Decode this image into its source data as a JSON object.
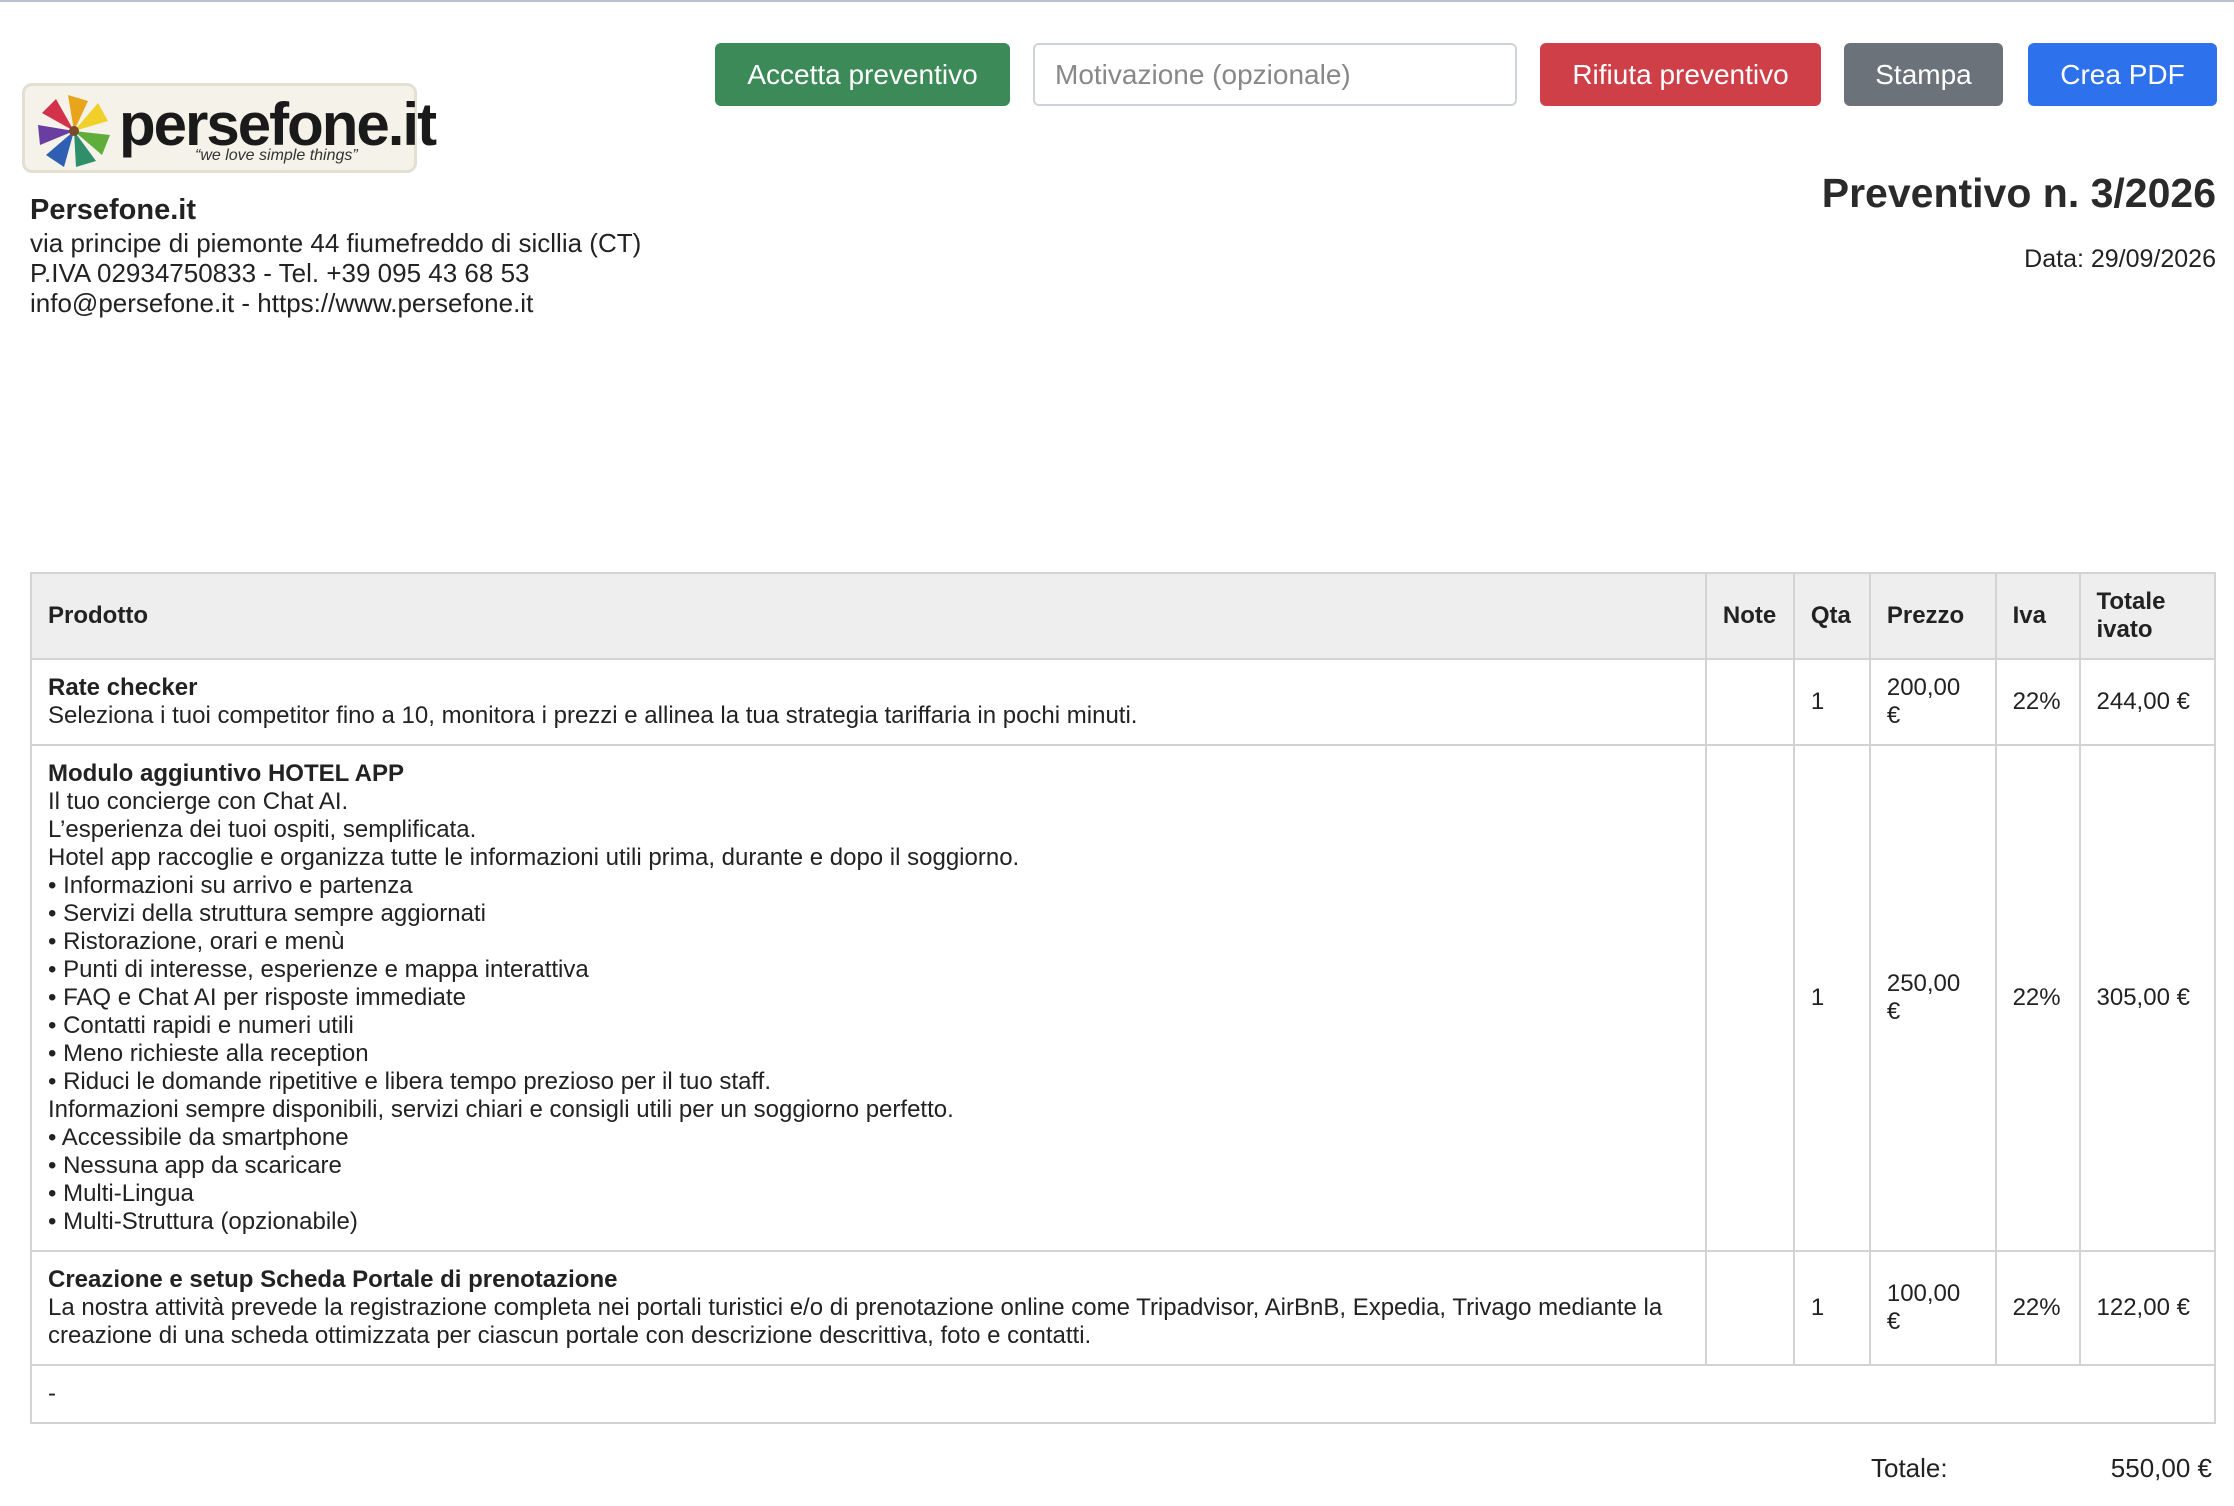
{
  "toolbar": {
    "accept_label": "Accetta preventivo",
    "reason_placeholder": "Motivazione (opzionale)",
    "reject_label": "Rifiuta preventivo",
    "print_label": "Stampa",
    "pdf_label": "Crea PDF"
  },
  "logo": {
    "text": "persefone.it",
    "tagline": "“we love simple things”"
  },
  "company": {
    "name": "Persefone.it",
    "address": "via principe di piemonte 44 fiumefreddo di sicllia (CT)",
    "vat_phone": "P.IVA 02934750833 - Tel. +39 095 43 68 53",
    "contacts": "info@persefone.it - https://www.persefone.it"
  },
  "quote": {
    "title": "Preventivo n. 3/2026",
    "date": "Data: 29/09/2026"
  },
  "table": {
    "headers": {
      "product": "Prodotto",
      "note": "Note",
      "qty": "Qta",
      "price": "Prezzo",
      "vat": "Iva",
      "total": "Totale ivato"
    },
    "rows": [
      {
        "name": "Rate checker",
        "description": "Seleziona i tuoi competitor fino a 10, monitora i prezzi e allinea la tua strategia tariffaria in pochi minuti.",
        "note": "",
        "qty": "1",
        "price": "200,00 €",
        "vat": "22%",
        "total": "244,00 €"
      },
      {
        "name": "Modulo aggiuntivo HOTEL APP",
        "description": "Il tuo concierge con Chat AI.\nL’esperienza dei tuoi ospiti, semplificata.\nHotel app raccoglie e organizza tutte le informazioni utili prima, durante e dopo il soggiorno.\n• Informazioni su arrivo e partenza\n• Servizi della struttura sempre aggiornati\n• Ristorazione, orari e menù\n• Punti di interesse, esperienze e mappa interattiva\n• FAQ e Chat AI per risposte immediate\n• Contatti rapidi e numeri utili\n• Meno richieste alla reception\n• Riduci le domande ripetitive e libera tempo prezioso per il tuo staff.\nInformazioni sempre disponibili, servizi chiari e consigli utili per un soggiorno perfetto.\n• Accessibile da smartphone\n• Nessuna app da scaricare\n• Multi-Lingua\n• Multi-Struttura (opzionabile)",
        "note": "",
        "qty": "1",
        "price": "250,00 €",
        "vat": "22%",
        "total": "305,00 €"
      },
      {
        "name": "Creazione e setup Scheda Portale di prenotazione",
        "description": "La nostra attività prevede la registrazione completa nei portali turistici e/o di prenotazione online come Tripadvisor, AirBnB, Expedia, Trivago mediante la creazione di una scheda ottimizzata per ciascun portale con descrizione descrittiva, foto e contatti.",
        "note": "",
        "qty": "1",
        "price": "100,00 €",
        "vat": "22%",
        "total": "122,00 €"
      }
    ],
    "footer_note": "-"
  },
  "totals": {
    "label": "Totale:",
    "value": "550,00 €"
  },
  "colors": {
    "accept": "#3c8a57",
    "reject": "#cf3f48",
    "print": "#6c7279",
    "pdf": "#2e71ec"
  }
}
